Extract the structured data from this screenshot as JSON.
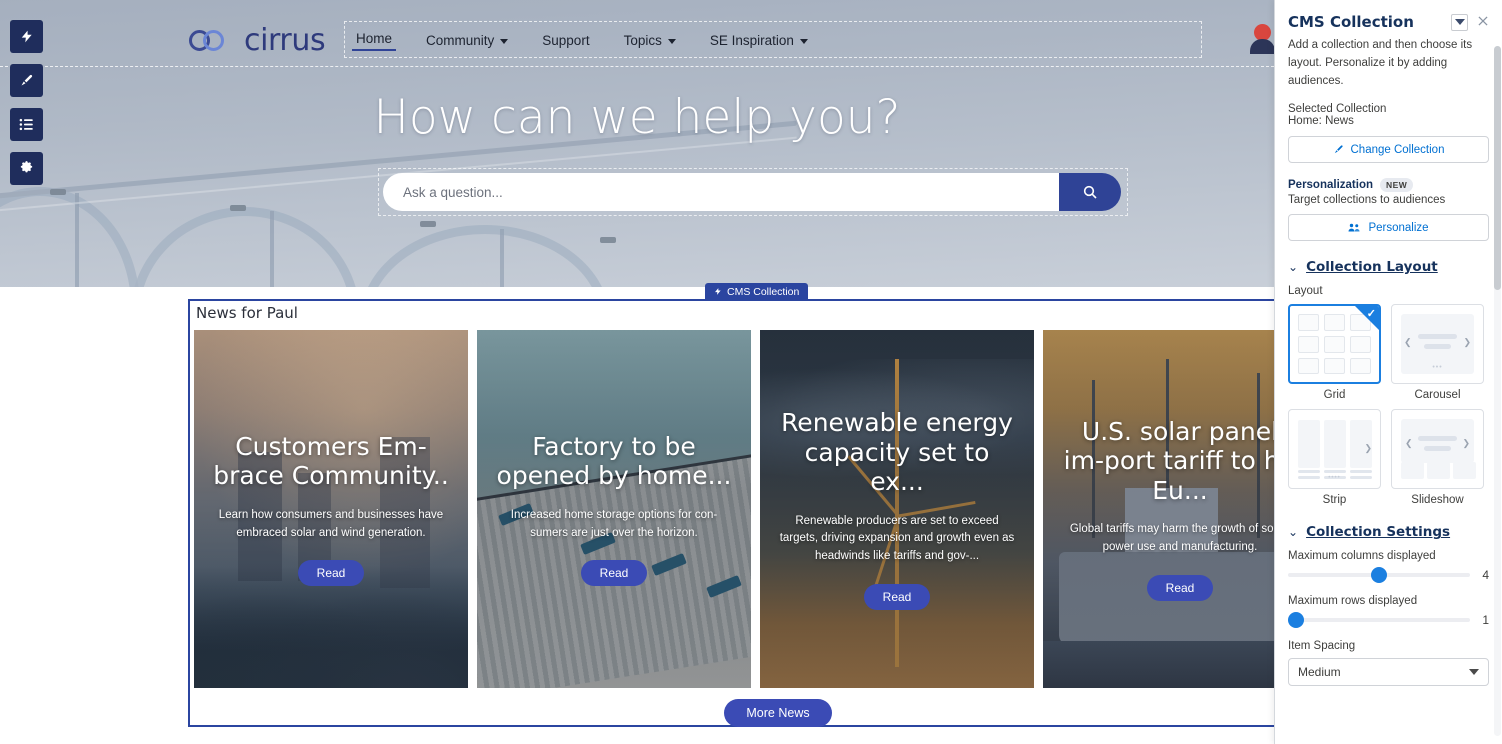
{
  "site": {
    "logo_text": "cirrus",
    "nav": [
      {
        "label": "Home",
        "has_caret": false,
        "active": true
      },
      {
        "label": "Community",
        "has_caret": true,
        "active": false
      },
      {
        "label": "Support",
        "has_caret": false,
        "active": false
      },
      {
        "label": "Topics",
        "has_caret": true,
        "active": false
      },
      {
        "label": "SE Inspiration",
        "has_caret": true,
        "active": false
      }
    ],
    "hero_title": "How can we help you?",
    "search_placeholder": "Ask a question...",
    "search_value": "",
    "search_icon": "search-icon"
  },
  "toolbar": {
    "items": [
      {
        "name": "lightning-icon",
        "glyph": "⚡"
      },
      {
        "name": "paintbrush-icon",
        "glyph": "✎"
      },
      {
        "name": "list-icon",
        "glyph": "☰"
      },
      {
        "name": "gear-icon",
        "glyph": "⚙"
      }
    ]
  },
  "canvas": {
    "component_tab_label": "CMS Collection",
    "component_tab_icon": "lightning-icon",
    "region_label": "News for Paul",
    "more_button": "More News",
    "cards": [
      {
        "title": "Customers Em-brace Community..",
        "desc": "Learn how consumers and businesses have embraced solar and wind generation.",
        "button": "Read"
      },
      {
        "title": "Factory to be opened by home...",
        "desc": "Increased home storage options for con-sumers are just over the horizon.",
        "button": "Read"
      },
      {
        "title": "Renewable energy capacity set to ex...",
        "desc": "Renewable producers are set to exceed targets, driving expansion and growth even as headwinds like tariffs and gov-...",
        "button": "Read"
      },
      {
        "title": "U.S. solar panel im-port tariff to hit Eu...",
        "desc": "Global tariffs may harm the growth of so-lar power use and manufacturing.",
        "button": "Read"
      }
    ]
  },
  "panel": {
    "title": "CMS Collection",
    "menu_icon": "chevron-down-icon",
    "close_icon": "close-icon",
    "helper_text": "Add a collection and then choose its layout. Personalize it by adding audiences.",
    "selected_collection_label": "Selected Collection",
    "selected_collection_value": "Home: News",
    "change_collection_button": "Change Collection",
    "change_collection_icon": "pencil-icon",
    "personalization_label": "Personalization",
    "personalization_badge": "NEW",
    "personalization_sub": "Target collections to audiences",
    "personalize_button": "Personalize",
    "personalize_icon": "people-icon",
    "collection_layout_section": "Collection Layout",
    "layout_label": "Layout",
    "layouts": [
      {
        "label": "Grid",
        "selected": true
      },
      {
        "label": "Carousel",
        "selected": false
      },
      {
        "label": "Strip",
        "selected": false
      },
      {
        "label": "Slideshow",
        "selected": false
      }
    ],
    "collection_settings_section": "Collection Settings",
    "max_columns_label": "Maximum columns displayed",
    "max_columns_value": "4",
    "max_rows_label": "Maximum rows displayed",
    "max_rows_value": "1",
    "item_spacing_label": "Item Spacing",
    "item_spacing_value": "Medium"
  },
  "colors": {
    "brand_blue": "#2f4396",
    "accent_blue": "#1b7fe0",
    "link_blue": "#0070d2",
    "panel_title": "#16325c",
    "read_button": "#3b4bb5"
  }
}
